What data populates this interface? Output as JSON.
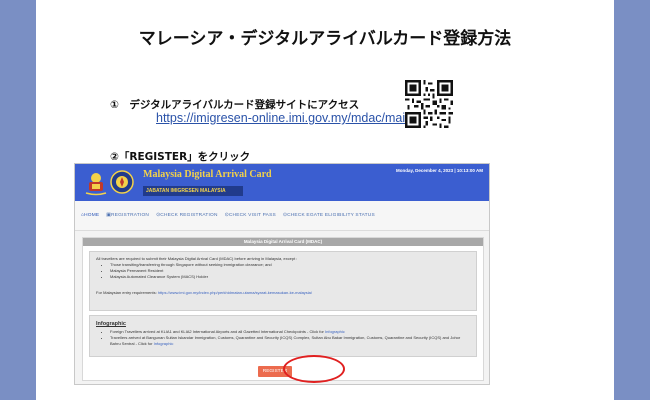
{
  "slide": {
    "title": "マレーシア・デジタルアライバルカード登録方法",
    "step1_text": "①　デジタルアライバルカード登録サイトにアクセス",
    "step1_url": "https://imigresen-online.imi.gov.my/mdac/main",
    "step2_text": "②「REGISTER」をクリック"
  },
  "site": {
    "header_title": "Malaysia Digital Arrival Card",
    "header_subtitle": "JABATAN IMIGRESEN MALAYSIA",
    "datetime": "Monday, December 4, 2023 | 10:13:00 AM",
    "nav": [
      {
        "label": "⌂HOME"
      },
      {
        "label": "▣REGISTRATION"
      },
      {
        "label": "⊙CHECK REGISTRATION"
      },
      {
        "label": "⊙CHECK VISIT PASS"
      },
      {
        "label": "⊙CHECK EGATE ELIGIBILITY STATUS"
      }
    ],
    "panel_title": "Malaysia Digital Arrival Card (MDAC)",
    "intro": "All travellers are required to submit their Malaysia Digital Arrival Card (MDAC) before arriving in Malaysia, except :",
    "exceptions": [
      "Those transiting/transferring through Singapore without seeking immigration clearance; and",
      "Malaysia Permanent Resident",
      "Malaysia Automated Clearance System (MACS) Holder"
    ],
    "entry_label": "For Malaysian entry  requirements: ",
    "entry_link": "https://www.imi.gov.my/index.php/perkhidmatan-utama/syarat-kemasukan-ke-malaysia/",
    "infographic_heading": "Infographic",
    "infographic_items": [
      {
        "text": "Foreign Travellers arrived at KLIA1 and KLIA2 International Airports and all Gazetted International Checkpoints - Click for ",
        "link": "Infographic"
      },
      {
        "text": "Travellers arrived at Bangunan Sultan Iskandar Immigration, Customs, Quarantine and Security (ICQS) Complex, Sultan Abu Bakar Immigration, Customs, Quarantine and Security (ICQS) and Johor Bahru Sentral - Click for ",
        "link": "Infographic"
      }
    ],
    "register_label": "REGISTER"
  },
  "colors": {
    "background": "#7a8fc4",
    "header_blue": "#3b5ed0",
    "header_gold": "#f3d24a",
    "register_button": "#ec6b4e",
    "highlight_circle": "#e02020",
    "link": "#2a52a8"
  },
  "icons": [
    "qr-code-icon",
    "coat-of-arms-icon",
    "immigration-emblem-icon",
    "home-icon"
  ]
}
